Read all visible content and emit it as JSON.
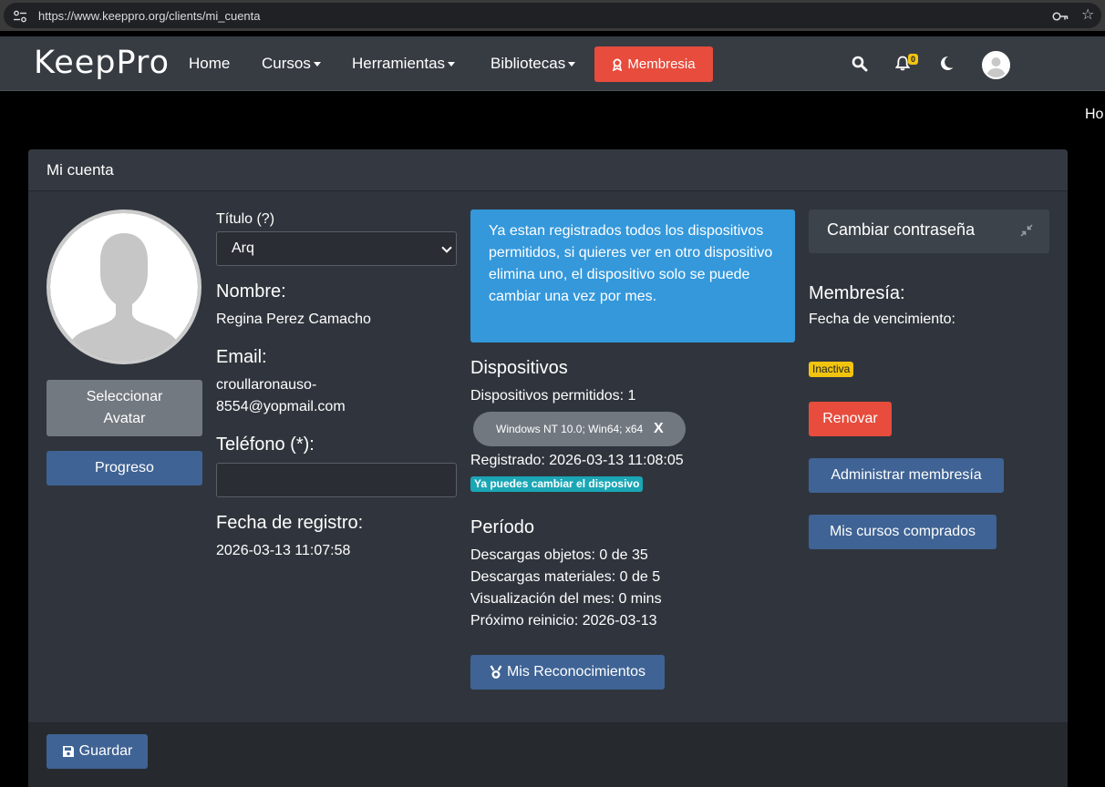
{
  "browser": {
    "url": "https://www.keeppro.org/clients/mi_cuenta"
  },
  "navbar": {
    "logo": "KeepPro",
    "home": "Home",
    "cursos": "Cursos",
    "herramientas": "Herramientas",
    "bibliotecas": "Bibliotecas",
    "membresia_button": "Membresia",
    "notifications_count": "0"
  },
  "corner_text": "Ho",
  "card": {
    "title": "Mi cuenta",
    "select_avatar_label_line1": "Seleccionar",
    "select_avatar_label_line2": "Avatar",
    "progreso_label": "Progreso",
    "guardar_label": "Guardar"
  },
  "profile": {
    "titulo_label": "Título (?)",
    "titulo_value": "Arq",
    "nombre_label": "Nombre:",
    "nombre_value": "Regina Perez Camacho",
    "email_label": "Email:",
    "email_line1": "croullaronauso-",
    "email_line2": "8554@yopmail.com",
    "telefono_label": "Teléfono (*):",
    "telefono_value": "",
    "fecha_registro_label": "Fecha de registro:",
    "fecha_registro_value": "2026-03-13 11:07:58"
  },
  "devices": {
    "alert_text": "Ya estan registrados todos los dispositivos permitidos, si quieres ver en otro dispositivo elimina uno, el dispositivo solo se puede cambiar una vez por mes.",
    "heading": "Dispositivos",
    "permitidos": "Dispositivos permitidos: 1",
    "device_name": "Windows NT 10.0; Win64; x64",
    "device_remove": "X",
    "registrado": "Registrado: 2026-03-13 11:08:05",
    "change_badge": "Ya puedes cambiar el disposivo"
  },
  "periodo": {
    "heading": "Período",
    "descargas_objetos": "Descargas objetos: 0 de 35",
    "descargas_materiales": "Descargas materiales: 0 de 5",
    "visualizacion": "Visualización del mes: 0 mins",
    "reinicio": "Próximo reinicio: 2026-03-13",
    "reconocimientos_button": "Mis Reconocimientos"
  },
  "membership": {
    "cambiar_contrasena": "Cambiar contraseña",
    "heading": "Membresía:",
    "vencimiento_label": "Fecha de vencimiento:",
    "status_badge": "Inactiva",
    "renovar": "Renovar",
    "administrar": "Administrar membresía",
    "mis_cursos": "Mis cursos comprados"
  },
  "colors": {
    "danger": "#e74c3c",
    "primary": "#3f6394",
    "info": "#3498db",
    "warning": "#f1c40f",
    "teal": "#1aa6b5"
  }
}
